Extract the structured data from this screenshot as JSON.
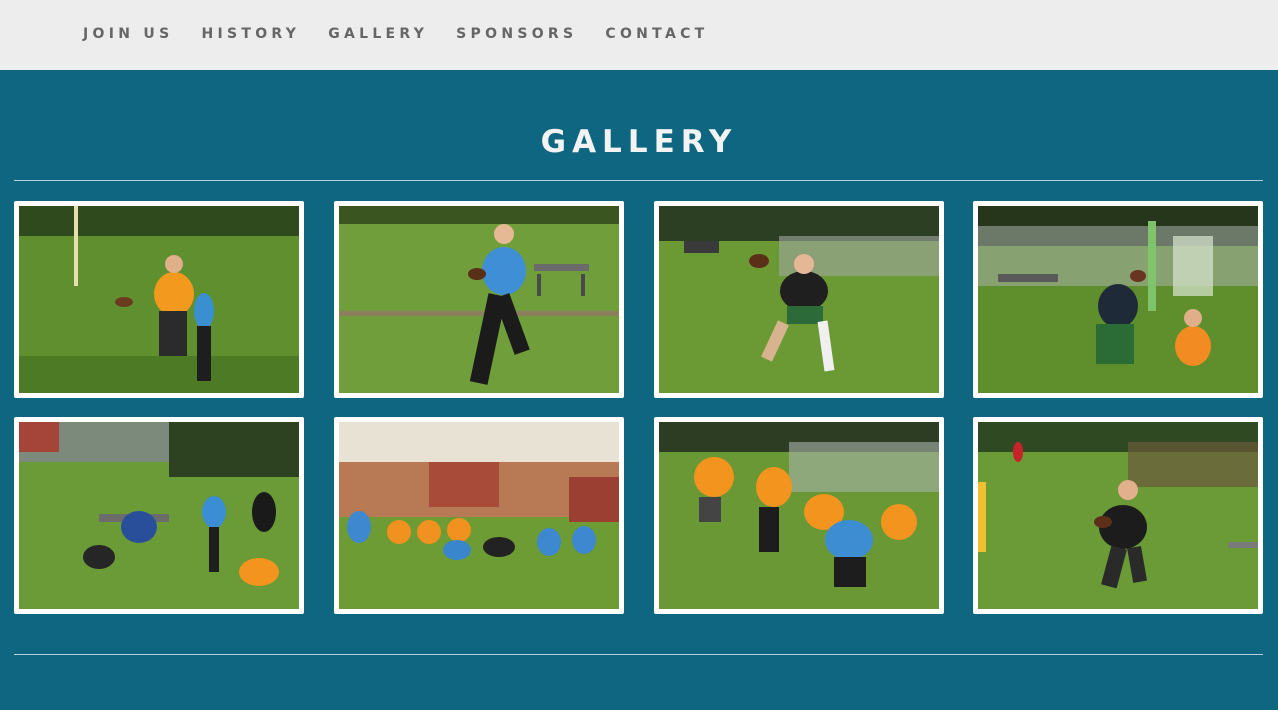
{
  "nav": {
    "items": [
      {
        "label": "JOIN US"
      },
      {
        "label": "HISTORY"
      },
      {
        "label": "GALLERY"
      },
      {
        "label": "SPONSORS"
      },
      {
        "label": "CONTACT"
      }
    ]
  },
  "page": {
    "title": "GALLERY"
  },
  "gallery": {
    "photos": [
      {
        "alt": "Player in orange bib carrying ball while defender pulls flag"
      },
      {
        "alt": "Player in blue bib running with ball"
      },
      {
        "alt": "Player in black hoodie throwing the ball"
      },
      {
        "alt": "Players near playground fence contesting a catch"
      },
      {
        "alt": "Group of players tackling near a bench"
      },
      {
        "alt": "Teams lined up at scrimmage"
      },
      {
        "alt": "Players in orange and blue bibs at the line"
      },
      {
        "alt": "Player in black shirt running with ball"
      }
    ]
  },
  "colors": {
    "page_bg": "#0e6680",
    "nav_bg": "#ededed",
    "nav_text": "#666666",
    "title_text": "#f3f3f3",
    "photo_border": "#ffffff"
  }
}
